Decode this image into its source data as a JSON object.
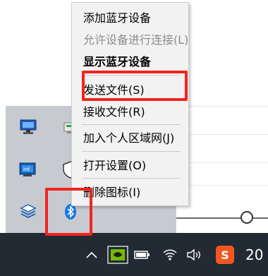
{
  "context_menu": {
    "items": [
      {
        "label": "添加蓝牙设备",
        "enabled": true,
        "bold": false
      },
      {
        "label": "允许设备进行连接(L)",
        "enabled": false,
        "bold": false
      },
      {
        "label": "显示蓝牙设备",
        "enabled": true,
        "bold": true
      },
      {
        "label": "发送文件(S)",
        "enabled": true,
        "bold": false
      },
      {
        "label": "接收文件(R)",
        "enabled": true,
        "bold": false
      },
      {
        "label": "加入个人区域网(J)",
        "enabled": true,
        "bold": false
      },
      {
        "label": "打开设置(O)",
        "enabled": true,
        "bold": false
      },
      {
        "label": "删除图标(I)",
        "enabled": true,
        "bold": false
      }
    ]
  },
  "tray_overflow": {
    "icons": [
      "monitor-icon",
      "network-drive-icon",
      "intel-graphics-icon",
      "shield-icon",
      "cube-icon",
      "bluetooth-icon"
    ]
  },
  "taskbar": {
    "icons": [
      "chevron-up-icon",
      "nvidia-icon",
      "battery-icon",
      "wifi-icon",
      "volume-icon",
      "sogou-input-icon"
    ],
    "sogou_label": "S",
    "clock_partial": "20"
  },
  "highlight_color": "#f2231f"
}
